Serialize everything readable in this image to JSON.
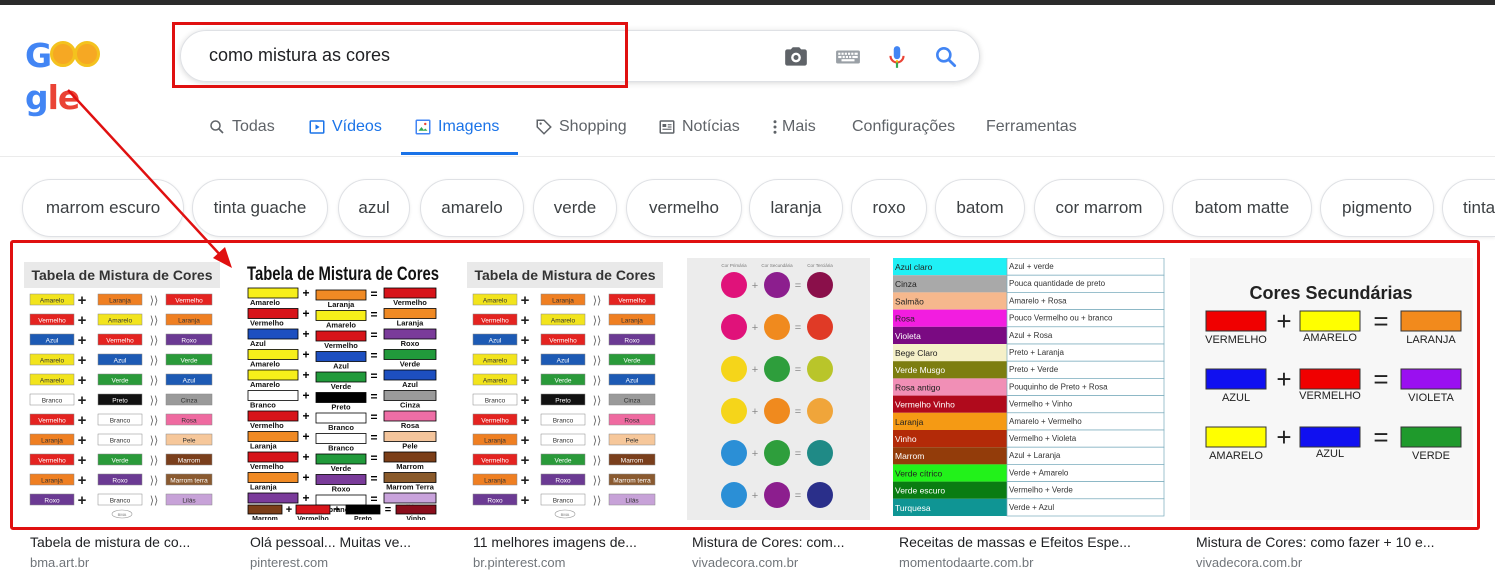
{
  "logo": {
    "text_a": "G",
    "text_b": "gle"
  },
  "search": {
    "query": "como mistura as cores"
  },
  "tabs": [
    {
      "label": "Todas"
    },
    {
      "label": "Vídeos"
    },
    {
      "label": "Imagens"
    },
    {
      "label": "Shopping"
    },
    {
      "label": "Notícias"
    },
    {
      "label": "Mais"
    },
    {
      "label": "Configurações"
    },
    {
      "label": "Ferramentas"
    }
  ],
  "chips": [
    "marrom escuro",
    "tinta guache",
    "azul",
    "amarelo",
    "verde",
    "vermelho",
    "laranja",
    "roxo",
    "batom",
    "cor marrom",
    "batom matte",
    "pigmento",
    "tinta"
  ],
  "results": [
    {
      "caption": "Tabela de mistura de co...",
      "source": "bma.art.br"
    },
    {
      "caption": "Olá pessoal... Muitas ve...",
      "source": "pinterest.com"
    },
    {
      "caption": "11 melhores imagens de...",
      "source": "br.pinterest.com"
    },
    {
      "caption": "Mistura de Cores: com...",
      "source": "vivadecora.com.br"
    },
    {
      "caption": "Receitas de massas e Efeitos Espe...",
      "source": "momentodaarte.com.br"
    },
    {
      "caption": "Mistura de Cores: como fazer + 10 e...",
      "source": "vivadecora.com.br"
    }
  ],
  "images": {
    "table1": {
      "title": "Tabela de Mistura de Cores",
      "rows": [
        [
          "Amarelo",
          "#f2e41d",
          "Laranja",
          "#ef7f22",
          "Vermelho",
          "#e42320"
        ],
        [
          "Vermelho",
          "#e42320",
          "Amarelo",
          "#f2e41d",
          "Laranja",
          "#ef7f22"
        ],
        [
          "Azul",
          "#1d5ab4",
          "Vermelho",
          "#e42320",
          "Roxo",
          "#6b3a93"
        ],
        [
          "Amarelo",
          "#f2e41d",
          "Azul",
          "#1d5ab4",
          "Verde",
          "#2a9a3a"
        ],
        [
          "Amarelo",
          "#f2e41d",
          "Verde",
          "#2a9a3a",
          "Azul",
          "#1d5ab4"
        ],
        [
          "Branco",
          "#ffffff",
          "Preto",
          "#111111",
          "Cinza",
          "#9a9a9a"
        ],
        [
          "Vermelho",
          "#e42320",
          "Branco",
          "#ffffff",
          "Rosa",
          "#ef6aa0"
        ],
        [
          "Laranja",
          "#ef7f22",
          "Branco",
          "#ffffff",
          "Pele",
          "#f6c79a"
        ],
        [
          "Vermelho",
          "#e42320",
          "Verde",
          "#2a9a3a",
          "Marrom",
          "#7a3f1c"
        ],
        [
          "Laranja",
          "#ef7f22",
          "Roxo",
          "#6b3a93",
          "Marrom terra",
          "#8a5a30"
        ],
        [
          "Roxo",
          "#6b3a93",
          "Branco",
          "#ffffff",
          "Lilás",
          "#c7a2d8"
        ]
      ],
      "footer": "BMA"
    },
    "table2": {
      "title": "Tabela de Mistura de Cores",
      "rows": [
        [
          "Amarelo",
          "#f7ef1a",
          "Laranja",
          "#f08a24",
          "Vermelho",
          "#d7141a"
        ],
        [
          "Vermelho",
          "#d7141a",
          "Amarelo",
          "#f7ef1a",
          "Laranja",
          "#f08a24"
        ],
        [
          "Azul",
          "#1d4fc0",
          "Vermelho",
          "#d7141a",
          "Roxo",
          "#7a3b9a"
        ],
        [
          "Amarelo",
          "#f7ef1a",
          "Azul",
          "#1d4fc0",
          "Verde",
          "#219a3b"
        ],
        [
          "Amarelo",
          "#f7ef1a",
          "Verde",
          "#219a3b",
          "Azul",
          "#1d4fc0"
        ],
        [
          "Branco",
          "#ffffff",
          "Preto",
          "#000000",
          "Cinza",
          "#9b9b9b"
        ],
        [
          "Vermelho",
          "#d7141a",
          "Branco",
          "#ffffff",
          "Rosa",
          "#ee6ea6"
        ],
        [
          "Laranja",
          "#f08a24",
          "Branco",
          "#ffffff",
          "Pele",
          "#f4c59c"
        ],
        [
          "Vermelho",
          "#d7141a",
          "Verde",
          "#219a3b",
          "Marrom",
          "#7b3e18"
        ],
        [
          "Laranja",
          "#f08a24",
          "Roxo",
          "#7a3b9a",
          "Marrom Terra",
          "#8a5a2b"
        ],
        [
          "Roxo",
          "#7a3b9a",
          "branco",
          "#ffffff",
          "Lilás",
          "#c9a3dc"
        ]
      ],
      "last": [
        "Marrom",
        "#7b3e18",
        "Vermelho",
        "#d7141a",
        "Preto",
        "#000000",
        "Vinho",
        "#8a0d1c"
      ]
    },
    "circles": {
      "headers": [
        "Cor Primária",
        "Cor Secundária",
        "Cor Terciária"
      ],
      "rows": [
        [
          "#e0127a",
          "#8c1e8e",
          "#8a0f4a"
        ],
        [
          "#e0127a",
          "#f08a1e",
          "#e03a26"
        ],
        [
          "#f5d51a",
          "#2e9e3c",
          "#b9c52a"
        ],
        [
          "#f5d51a",
          "#f08a1e",
          "#f0a53a"
        ],
        [
          "#2b8fd6",
          "#2e9e3c",
          "#1f8a86"
        ],
        [
          "#2b8fd6",
          "#8c1e8e",
          "#2a2f8a"
        ]
      ]
    },
    "list": {
      "rows": [
        [
          "Azul claro",
          "#1ff0f5",
          "Azul + verde"
        ],
        [
          "Cinza",
          "#a9a9a9",
          "Pouca quantidade de preto"
        ],
        [
          "Salmão",
          "#f6b88d",
          "Amarelo + Rosa"
        ],
        [
          "Rosa",
          "#f21de0",
          "Pouco Vermelho ou + branco"
        ],
        [
          "Violeta",
          "#7a0a82",
          "Azul + Rosa"
        ],
        [
          "Bege Claro",
          "#f5f0c8",
          "Preto + Laranja"
        ],
        [
          "Verde Musgo",
          "#7d7e10",
          "Preto + Verde"
        ],
        [
          "Rosa antigo",
          "#f18fb6",
          "Pouquinho de Preto + Rosa"
        ],
        [
          "Vermelho Vinho",
          "#b00a1c",
          "Vermelho + Vinho"
        ],
        [
          "Laranja",
          "#f59a14",
          "Amarelo + Vermelho"
        ],
        [
          "Vinho",
          "#b32a08",
          "Vermelho + Violeta"
        ],
        [
          "Marrom",
          "#933c0a",
          "Azul + Laranja"
        ],
        [
          "Verde cítrico",
          "#22f21a",
          "Verde + Amarelo"
        ],
        [
          "Verde escuro",
          "#0a7c12",
          "Vermelho + Verde"
        ],
        [
          "Turquesa",
          "#0f9594",
          "Verde + Azul"
        ]
      ]
    },
    "secundarias": {
      "title": "Cores Secundárias",
      "rows": [
        [
          "VERMELHO",
          "#f00000",
          "AMARELO",
          "#ffff00",
          "LARANJA",
          "#f28a1c"
        ],
        [
          "AZUL",
          "#1010f0",
          "VERMELHO",
          "#f00000",
          "VIOLETA",
          "#9a10f0"
        ],
        [
          "AMARELO",
          "#ffff00",
          "AZUL",
          "#1010f0",
          "VERDE",
          "#1f9a2c"
        ]
      ]
    }
  }
}
